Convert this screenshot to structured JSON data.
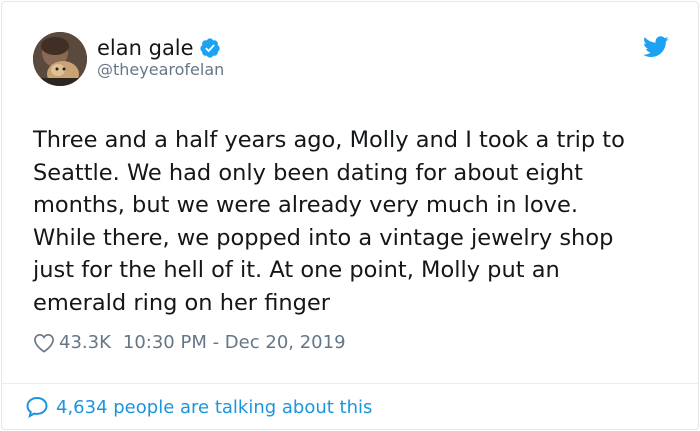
{
  "author": {
    "name": "elan gale",
    "handle": "@theyearofelan",
    "verified": true
  },
  "tweet": {
    "text": "Three and a half years ago, Molly and I took a trip to\nSeattle. We had only been dating for about eight\nmonths, but we were already very much in love.\nWhile there, we popped into a vintage jewelry shop\njust for the hell of it. At one point, Molly put an\nemerald ring on her finger",
    "likes": "43.3K",
    "timestamp": "10:30 PM - Dec 20, 2019"
  },
  "footer": {
    "conversation": "4,634 people are talking about this"
  },
  "icons": {
    "verified": "verified-badge-icon",
    "brand": "twitter-bird-icon",
    "like": "heart-icon",
    "reply": "speech-bubble-icon"
  },
  "colors": {
    "brand_blue": "#1da1f2",
    "link_blue": "#1b95e0",
    "muted": "#657786",
    "text": "#14171a"
  }
}
